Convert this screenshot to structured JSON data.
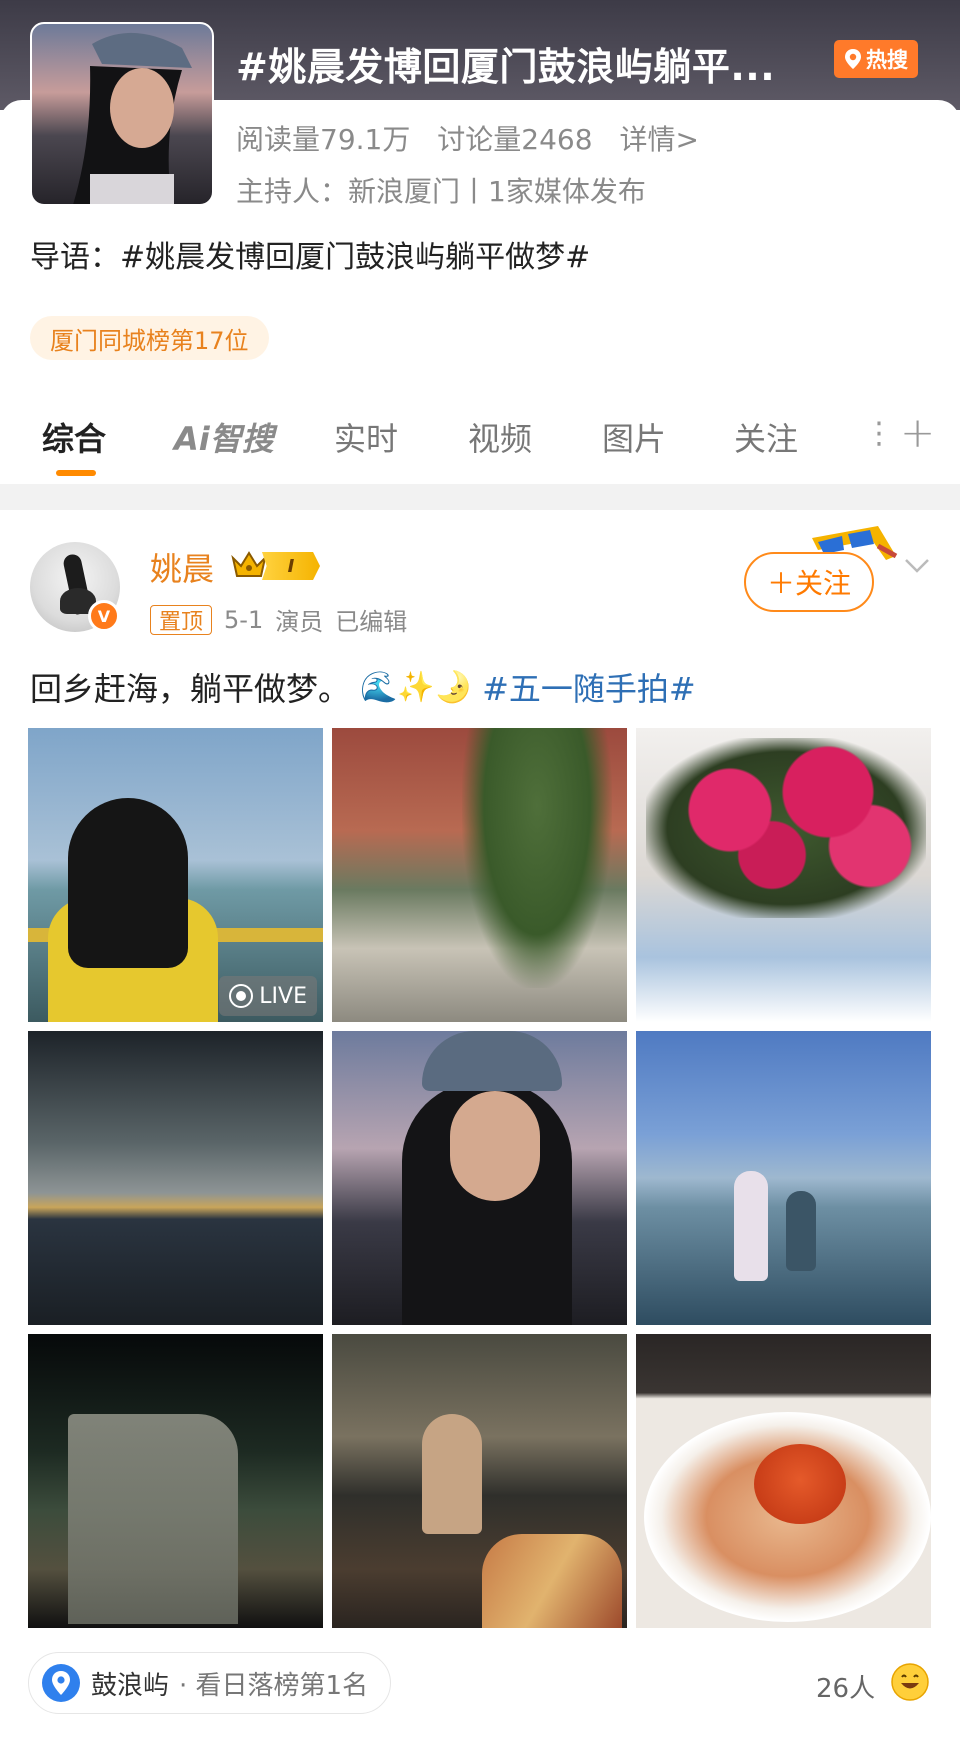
{
  "header": {
    "title": "#姚晨发博回厦门鼓浪屿躺平...",
    "hot_label": "热搜",
    "reads": "阅读量79.1万",
    "discussions": "讨论量2468",
    "details": "详情>",
    "host": "主持人：新浪厦门丨1家媒体发布",
    "intro": "导语：#姚晨发博回厦门鼓浪屿躺平做梦#",
    "rank": "厦门同城榜第17位"
  },
  "tabs": [
    {
      "label": "综合",
      "active": true
    },
    {
      "label": "Ai智搜"
    },
    {
      "label": "实时"
    },
    {
      "label": "视频"
    },
    {
      "label": "图片"
    },
    {
      "label": "关注"
    }
  ],
  "post": {
    "user_name": "姚晨",
    "level": "I",
    "pin_label": "置顶",
    "date": "5-1",
    "role": "演员",
    "edited": "已编辑",
    "follow_label": "＋关注",
    "text": "回乡赶海，躺平做梦。",
    "emojis": "🌊✨🌛",
    "hashtag": "#五一随手拍#",
    "live_label": "LIVE",
    "location": "鼓浪屿",
    "location_rank": "· 看日落榜第1名",
    "people_count": "26人"
  },
  "colors": {
    "accent": "#ff8a00",
    "name": "#e8821e",
    "hashtag": "#2e6fb5",
    "hot": "#ff7a2a"
  },
  "icons": [
    "location-pin-icon",
    "crown-icon",
    "sunglasses-icon",
    "chevron-down-icon",
    "live-icon",
    "location-icon",
    "smile-icon",
    "plus-icon",
    "more-icon"
  ]
}
